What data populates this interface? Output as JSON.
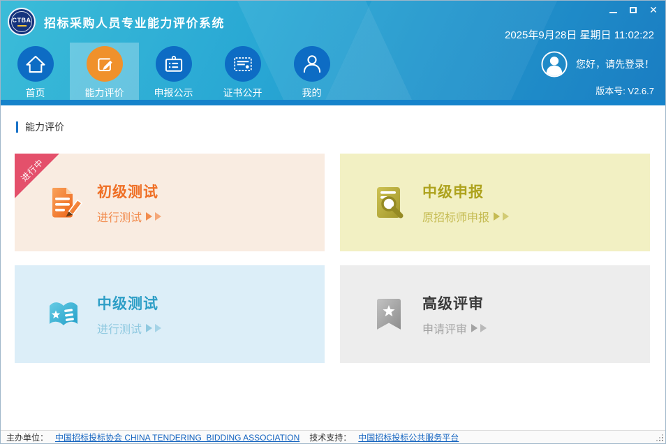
{
  "window": {
    "title": "招标采购人员专业能力评价系统",
    "logo_text": "CTBA",
    "datetime": "2025年9月28日 星期日 11:02:22"
  },
  "nav": {
    "items": [
      {
        "label": "首页",
        "icon": "home-icon",
        "active": false
      },
      {
        "label": "能力评价",
        "icon": "edit-icon",
        "active": true
      },
      {
        "label": "申报公示",
        "icon": "badge-icon",
        "active": false
      },
      {
        "label": "证书公开",
        "icon": "certificate-icon",
        "active": false
      },
      {
        "label": "我的",
        "icon": "user-icon",
        "active": false
      }
    ],
    "greeting": "您好，请先登录！",
    "version": "版本号: V2.6.7"
  },
  "section": {
    "title": "能力评价"
  },
  "cards": [
    {
      "title": "初级测试",
      "subtitle": "进行测试",
      "ribbon": "进行中",
      "theme": "orange",
      "icon": "document-pencil-icon"
    },
    {
      "title": "中级申报",
      "subtitle": "原招标师申报",
      "ribbon": "",
      "theme": "olive",
      "icon": "document-magnifier-icon"
    },
    {
      "title": "中级测试",
      "subtitle": "进行测试",
      "ribbon": "",
      "theme": "blue",
      "icon": "open-book-icon"
    },
    {
      "title": "高级评审",
      "subtitle": "申请评审",
      "ribbon": "",
      "theme": "gray",
      "icon": "bookmark-icon"
    }
  ],
  "footer": {
    "organizer_label": "主办单位：",
    "organizer_link": "中国招标投标协会 CHINA TENDERING  BIDDING ASSOCIATION",
    "support_label": "技术支持：",
    "support_link": "中国招标投标公共服务平台"
  },
  "colors": {
    "header_gradient_start": "#3bbcd8",
    "header_gradient_end": "#1a7dc2",
    "header_bottom_bar": "#1583cb",
    "nav_circle_blue": "#0d6cc4",
    "active_orange": "#f0912b",
    "section_bar_blue": "#1a73c8",
    "ribbon_red": "#e4506b",
    "card_orange_bg": "#f9ece1",
    "card_orange_accent": "#ef6f25",
    "card_olive_bg": "#f2f0c3",
    "card_olive_accent": "#ada21c",
    "card_blue_bg": "#dceef8",
    "card_blue_accent": "#2d9ec6",
    "card_gray_bg": "#ededed",
    "card_gray_accent": "#3a3a3a",
    "link_blue": "#1464c0"
  }
}
